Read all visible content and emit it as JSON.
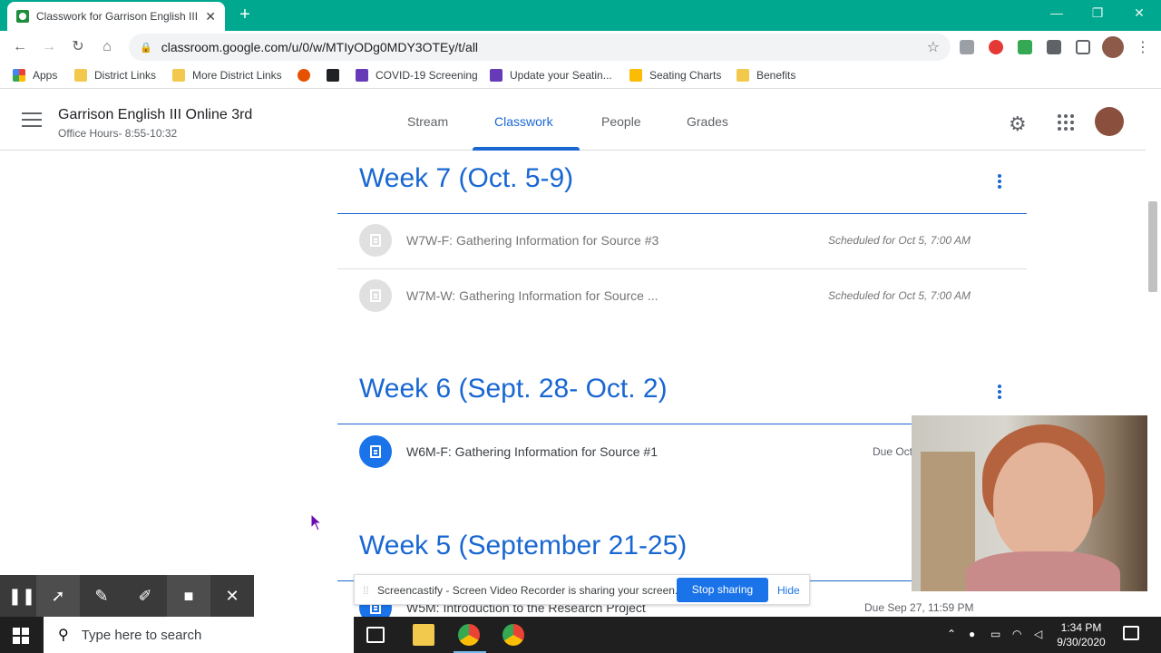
{
  "browser": {
    "tab_title": "Classwork for Garrison English III",
    "url": "classroom.google.com/u/0/w/MTIyODg0MDY3OTEy/t/all",
    "bookmarks": [
      {
        "label": "Apps"
      },
      {
        "label": "District Links"
      },
      {
        "label": "More District Links"
      },
      {
        "label": "COVID-19 Screening"
      },
      {
        "label": "Update your Seatin..."
      },
      {
        "label": "Seating Charts"
      },
      {
        "label": "Benefits"
      }
    ]
  },
  "classroom": {
    "class_name": "Garrison English III Online 3rd",
    "class_subtitle": "Office Hours- 8:55-10:32",
    "tabs": [
      "Stream",
      "Classwork",
      "People",
      "Grades"
    ],
    "active_tab": "Classwork"
  },
  "topics": [
    {
      "title": "Week 7 (Oct. 5-9)",
      "items": [
        {
          "title": "W7W-F: Gathering Information for Source #3",
          "meta": "Scheduled for Oct 5, 7:00 AM"
        },
        {
          "title": "W7M-W: Gathering Information for Source ...",
          "meta": "Scheduled for Oct 5, 7:00 AM"
        }
      ]
    },
    {
      "title": "Week 6 (Sept. 28- Oct. 2)",
      "items": [
        {
          "title": "W6M-F: Gathering Information for Source #1",
          "meta": "Due Oct"
        }
      ]
    },
    {
      "title": "Week 5 (September 21-25)",
      "items": [
        {
          "title": "W5M: Introduction to the Research Project",
          "meta": "Due Sep 27, 11:59 PM"
        }
      ]
    }
  ],
  "screencastify": {
    "message": "Screencastify - Screen Video Recorder is sharing your screen.",
    "stop_label": "Stop sharing",
    "hide_label": "Hide"
  },
  "taskbar": {
    "search_placeholder": "Type here to search",
    "time": "1:34 PM",
    "date": "9/30/2020"
  },
  "colors": {
    "accent": "#1967d2",
    "tabstrip": "#00a88f",
    "stop_button": "#1a73e8"
  }
}
